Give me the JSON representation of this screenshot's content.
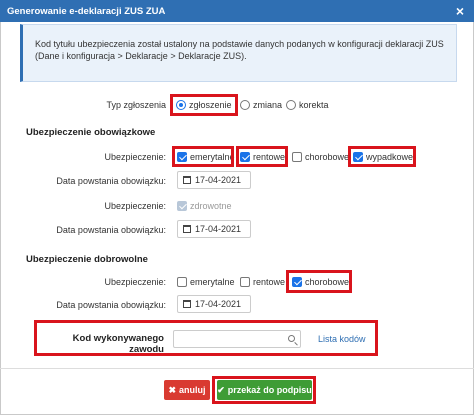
{
  "window": {
    "title": "Generowanie e-deklaracji ZUS ZUA",
    "close_glyph": "×"
  },
  "info": {
    "text": "Kod tytułu ubezpieczenia został ustalony na podstawie danych podanych w konfiguracji deklaracji ZUS (Dane i konfiguracja > Deklaracje > Deklaracje ZUS)."
  },
  "declaration_type": {
    "label": "Typ zgłoszenia",
    "options": [
      {
        "label": "zgłoszenie",
        "selected": true
      },
      {
        "label": "zmiana",
        "selected": false
      },
      {
        "label": "korekta",
        "selected": false
      }
    ]
  },
  "mandatory": {
    "heading": "Ubezpieczenie obowiązkowe",
    "insurance_label": "Ubezpieczenie:",
    "options": [
      {
        "label": "emerytalne",
        "checked": true
      },
      {
        "label": "rentowe",
        "checked": true
      },
      {
        "label": "chorobowe",
        "checked": false
      },
      {
        "label": "wypadkowe",
        "checked": true
      }
    ],
    "date_label": "Data powstania obowiązku:",
    "date_value": "17-04-2021",
    "health_label": "Ubezpieczenie:",
    "health_option": "zdrowotne",
    "health_date_label": "Data powstania obowiązku:",
    "health_date_value": "17-04-2021"
  },
  "voluntary": {
    "heading": "Ubezpieczenie dobrowolne",
    "insurance_label": "Ubezpieczenie:",
    "options": [
      {
        "label": "emerytalne",
        "checked": false
      },
      {
        "label": "rentowe",
        "checked": false
      },
      {
        "label": "chorobowe",
        "checked": true
      }
    ],
    "date_label": "Data powstania obowiązku:",
    "date_value": "17-04-2021"
  },
  "occupation": {
    "label": "Kod wykonywanego zawodu",
    "value": "",
    "link": "Lista kodów"
  },
  "buttons": {
    "cancel": "anuluj",
    "cancel_glyph": "✖",
    "submit": "przekaż do podpisu",
    "submit_glyph": "✔"
  },
  "colors": {
    "title_bar": "#2f6fb3",
    "highlight": "#d9141c",
    "cancel": "#d93a31",
    "submit": "#3e9c35"
  }
}
